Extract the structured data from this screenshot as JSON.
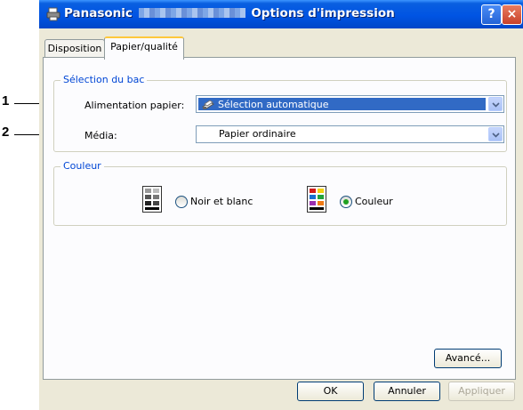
{
  "window": {
    "title_prefix": "Panasonic",
    "title_suffix": "Options d'impression",
    "help_glyph": "?",
    "close_glyph": "×"
  },
  "tabs": [
    {
      "label": "Disposition"
    },
    {
      "label": "Papier/qualité",
      "active": true
    }
  ],
  "tray_group": {
    "legend": "Sélection du bac",
    "paper_source_label": "Alimentation papier:",
    "paper_source_value": "Sélection automatique",
    "media_label": "Média:",
    "media_value": "Papier ordinaire"
  },
  "color_group": {
    "legend": "Couleur",
    "options": [
      {
        "label": "Noir et blanc",
        "selected": false
      },
      {
        "label": "Couleur",
        "selected": true
      }
    ]
  },
  "buttons": {
    "advanced": "Avancé...",
    "ok": "OK",
    "cancel": "Annuler",
    "apply": "Appliquer"
  },
  "callouts": [
    "1",
    "2"
  ],
  "colors": {
    "accent": "#0054e3",
    "legend": "#0046d5",
    "selection": "#316ac5"
  }
}
